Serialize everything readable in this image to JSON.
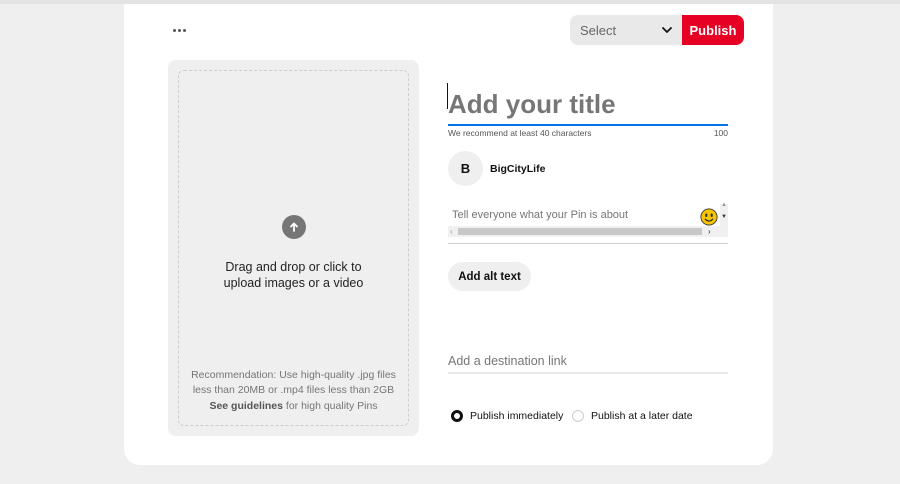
{
  "toolbar": {
    "more_icon": "more-horizontal-icon",
    "select_label": "Select",
    "publish_label": "Publish",
    "publish_color": "#e60023"
  },
  "upload": {
    "icon": "upload-arrow-icon",
    "line1": "Drag and drop or click to",
    "line2": "upload images or a video",
    "rec_line1": "Recommendation: Use high-quality .jpg files",
    "rec_line2": "less than 20MB or .mp4 files less than 2GB",
    "guidelines_link": "See guidelines",
    "guidelines_suffix": " for high quality Pins"
  },
  "form": {
    "title_placeholder": "Add your title",
    "title_value": "",
    "title_hint": "We recommend at least 40 characters",
    "title_count": "100",
    "user_initial": "B",
    "username": "BigCityLife",
    "description_placeholder": "Tell everyone what your Pin is about",
    "description_value": "",
    "emoji_icon": "smiley-emoji-icon",
    "alt_text_label": "Add alt text",
    "link_placeholder": "Add a destination link",
    "link_value": ""
  },
  "schedule": {
    "option_now": "Publish immediately",
    "option_later": "Publish at a later date",
    "selected": "now"
  },
  "colors": {
    "accent_blue": "#0074e8",
    "background": "#efefef"
  }
}
